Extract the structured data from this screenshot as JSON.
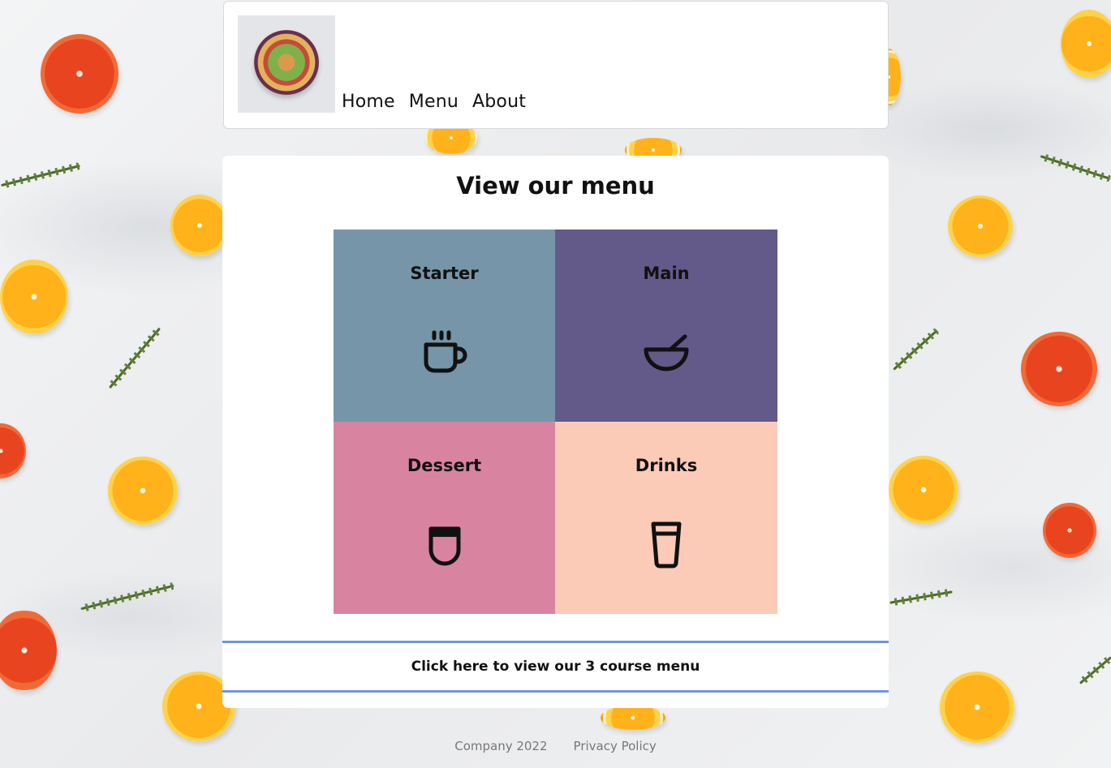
{
  "header": {
    "logo_icon": "salad-bowl-photo",
    "nav": [
      {
        "label": "Home"
      },
      {
        "label": "Menu"
      },
      {
        "label": "About"
      }
    ]
  },
  "main": {
    "title": "View our menu",
    "tiles": [
      {
        "label": "Starter",
        "icon": "coffee-cup-icon",
        "color": "#7695a8"
      },
      {
        "label": "Main",
        "icon": "bowl-icon",
        "color": "#635a89"
      },
      {
        "label": "Dessert",
        "icon": "dessert-cup-icon",
        "color": "#d884a1"
      },
      {
        "label": "Drinks",
        "icon": "glass-icon",
        "color": "#fccbb7"
      }
    ],
    "cta_label": "Click here to view our 3 course menu",
    "cta_border_color": "#6f97dd"
  },
  "footer": {
    "company": "Company 2022",
    "privacy": "Privacy Policy"
  }
}
